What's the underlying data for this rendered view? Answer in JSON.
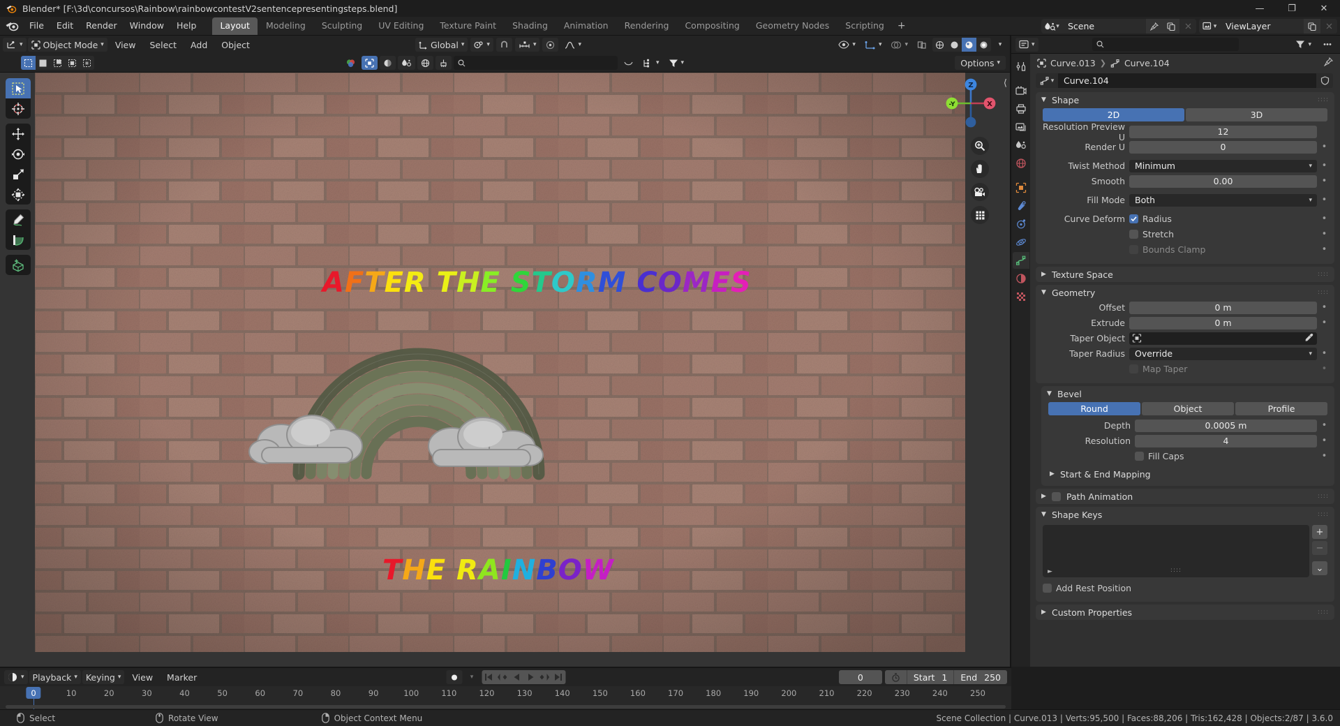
{
  "window": {
    "title": "Blender* [F:\\3d\\concursos\\Rainbow\\rainbowcontestV2sentencepresentingsteps.blend]",
    "minimize": "—",
    "maximize": "❐",
    "close": "✕"
  },
  "menubar": {
    "items": [
      "File",
      "Edit",
      "Render",
      "Window",
      "Help"
    ],
    "workspaces": [
      {
        "label": "Layout",
        "active": true
      },
      {
        "label": "Modeling",
        "active": false
      },
      {
        "label": "Sculpting",
        "active": false
      },
      {
        "label": "UV Editing",
        "active": false
      },
      {
        "label": "Texture Paint",
        "active": false
      },
      {
        "label": "Shading",
        "active": false
      },
      {
        "label": "Animation",
        "active": false
      },
      {
        "label": "Rendering",
        "active": false
      },
      {
        "label": "Compositing",
        "active": false
      },
      {
        "label": "Geometry Nodes",
        "active": false
      },
      {
        "label": "Scripting",
        "active": false
      }
    ],
    "add_workspace": "+",
    "scene_name": "Scene",
    "viewlayer_name": "ViewLayer"
  },
  "viewport": {
    "mode": "Object Mode",
    "menus": [
      "View",
      "Select",
      "Add",
      "Object"
    ],
    "transform_orientation": "Global",
    "options_label": "Options",
    "search_placeholder": "",
    "gizmo_axes": {
      "z": "Z",
      "y": "-Y",
      "x": "X"
    },
    "tools": [
      "tweak-select-tool",
      "cursor-tool",
      "move-tool",
      "rotate-tool",
      "scale-tool",
      "transform-tool",
      "annotate-tool",
      "measure-tool",
      "add-cube-tool"
    ],
    "scene_text_top": "AFTER THE STORM COMES",
    "scene_text_bottom": "THE RAINBOW",
    "text_colors_top": [
      "#e8182a",
      "#f07018",
      "#f5a818",
      "#fbe00e",
      "#f3ec12",
      "#e9f017",
      "#c9f020",
      "#88ee25",
      "#2fd63a",
      "#23c98c",
      "#2ec9c9",
      "#2f8fe0",
      "#2f4fd8",
      "#4a2fd0",
      "#6a27c8",
      "#9b27c4",
      "#c71fc0",
      "#e41fb7",
      "#f35ec9",
      "#f58fd6",
      "#f7a8dd"
    ],
    "text_colors_bottom": [
      "#e8182a",
      "#f5a818",
      "#fbe00e",
      "#f0ea12",
      "#8fe61e",
      "#22c93f",
      "#1fb0e0",
      "#2f3fd0",
      "#7a22c8",
      "#c41fc4",
      "#f07ad0"
    ]
  },
  "properties": {
    "breadcrumb": [
      "Curve.013",
      "Curve.104"
    ],
    "datablock_name": "Curve.104",
    "tabs": [
      "tool-tab",
      "render-tab",
      "output-tab",
      "view-layer-tab",
      "scene-tab",
      "world-tab",
      "object-tab",
      "modifier-tab",
      "particles-tab",
      "physics-tab",
      "object-data-tab",
      "material-tab",
      "texture-tab"
    ],
    "selected_tab": "object-data-tab",
    "panels": {
      "shape": {
        "title": "Shape",
        "open": true,
        "dimension_toggle": {
          "options": [
            "2D",
            "3D"
          ],
          "selected": "2D"
        },
        "rows": [
          {
            "label": "Resolution Preview U",
            "value": "12",
            "decorator": false
          },
          {
            "label": "Render U",
            "value": "0",
            "decorator": true
          }
        ],
        "twist_method": {
          "label": "Twist Method",
          "value": "Minimum"
        },
        "smooth": {
          "label": "Smooth",
          "value": "0.00"
        },
        "fill_mode": {
          "label": "Fill Mode",
          "value": "Both"
        },
        "curve_deform": {
          "label": "Curve Deform",
          "checks": [
            {
              "label": "Radius",
              "checked": true,
              "enabled": true
            },
            {
              "label": "Stretch",
              "checked": false,
              "enabled": true
            },
            {
              "label": "Bounds Clamp",
              "checked": false,
              "enabled": false
            }
          ]
        }
      },
      "texture_space": {
        "title": "Texture Space",
        "open": false
      },
      "geometry": {
        "title": "Geometry",
        "open": true,
        "offset": {
          "label": "Offset",
          "value": "0 m"
        },
        "extrude": {
          "label": "Extrude",
          "value": "0 m"
        },
        "taper_object": {
          "label": "Taper Object",
          "value": ""
        },
        "taper_radius": {
          "label": "Taper Radius",
          "value": "Override"
        },
        "map_taper": {
          "label": "Map Taper",
          "checked": false
        }
      },
      "bevel": {
        "title": "Bevel",
        "open": true,
        "type_toggle": {
          "options": [
            "Round",
            "Object",
            "Profile"
          ],
          "selected": "Round"
        },
        "depth": {
          "label": "Depth",
          "value": "0.0005 m"
        },
        "resolution": {
          "label": "Resolution",
          "value": "4"
        },
        "fill_caps": {
          "label": "Fill Caps",
          "checked": false
        }
      },
      "start_end_mapping": {
        "title": "Start & End Mapping",
        "open": false
      },
      "path_animation": {
        "title": "Path Animation",
        "open": false,
        "checked": false
      },
      "shape_keys": {
        "title": "Shape Keys",
        "open": true,
        "list_items": [],
        "add_button": "+",
        "remove_button": "−",
        "menu_button": "⌄",
        "add_rest_position": {
          "label": "Add Rest Position",
          "checked": false
        }
      },
      "custom_properties": {
        "title": "Custom Properties",
        "open": false
      }
    }
  },
  "timeline": {
    "menus": [
      "Playback",
      "Keying",
      "View",
      "Marker"
    ],
    "current_frame": "0",
    "start_label": "Start",
    "start_value": "1",
    "end_label": "End",
    "end_value": "250",
    "ticks": [
      "0",
      "10",
      "20",
      "30",
      "40",
      "50",
      "60",
      "70",
      "80",
      "90",
      "100",
      "110",
      "120",
      "130",
      "140",
      "150",
      "160",
      "170",
      "180",
      "190",
      "200",
      "210",
      "220",
      "230",
      "240",
      "250"
    ],
    "playhead_frame": "0"
  },
  "status": {
    "left_items": [
      {
        "icon": "mouse-left-icon",
        "label": "Select"
      },
      {
        "icon": "mouse-middle-icon",
        "label": "Rotate View"
      },
      {
        "icon": "mouse-right-icon",
        "label": "Object Context Menu"
      }
    ],
    "right_text": "Scene Collection | Curve.013 | Verts:95,500 | Faces:88,206 | Tris:162,428 | Objects:2/87 | 3.6.0"
  },
  "colors": {
    "accent_blue": "#4772b3",
    "panel_bg": "#383838",
    "editor_bg": "#303030",
    "header_bg": "#232323",
    "field_bg": "#545454",
    "dark_field": "#282828"
  }
}
